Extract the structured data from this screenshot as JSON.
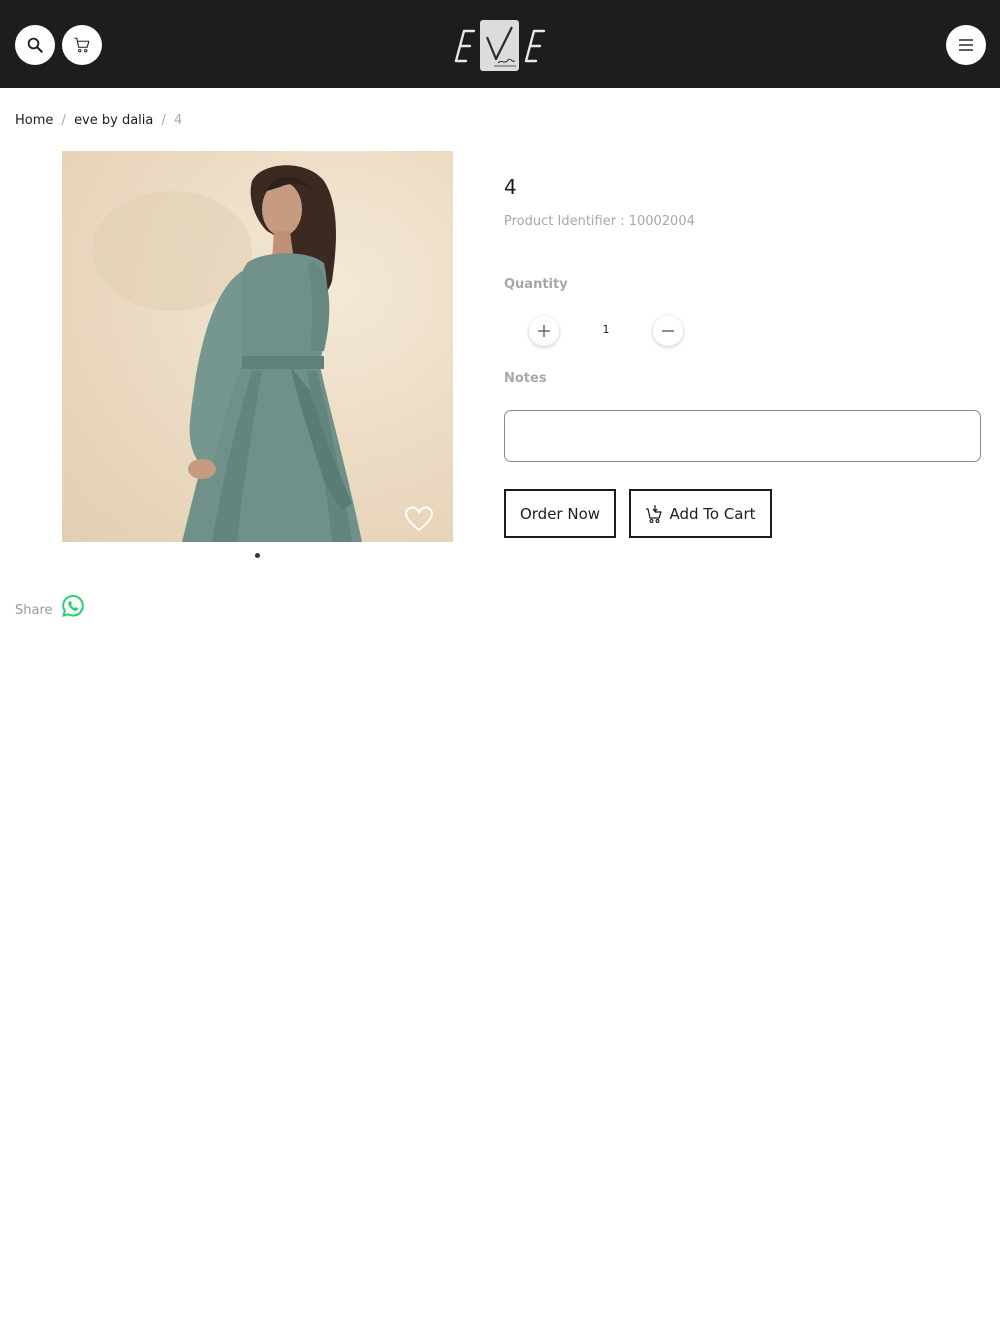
{
  "header": {
    "search_icon": "search-icon",
    "cart_icon": "cart-icon",
    "menu_icon": "hamburger-menu-icon",
    "logo": "EVE by dalia logo",
    "background_color": "#1d1d1b"
  },
  "breadcrumb": {
    "home": "Home",
    "separator": "/",
    "category": "eve by dalia",
    "current": "4"
  },
  "product": {
    "title": "4",
    "identifier": "Product Identifier : 10002004",
    "image_alt": "Model wearing sage green long-sleeve wrap dress",
    "favorite_icon": "heart-icon",
    "gallery_dots": 1
  },
  "quantity": {
    "label": "Quantity",
    "value": "1",
    "increase_icon": "plus-icon",
    "decrease_icon": "minus-icon"
  },
  "notes": {
    "label": "Notes",
    "value": "",
    "placeholder": ""
  },
  "actions": {
    "order_now": "Order Now",
    "add_to_cart": "Add To Cart",
    "add_to_cart_icon": "cart-add-icon"
  },
  "share": {
    "label": "Share",
    "whatsapp_icon": "whatsapp-icon",
    "whatsapp_color": "#25d366"
  }
}
